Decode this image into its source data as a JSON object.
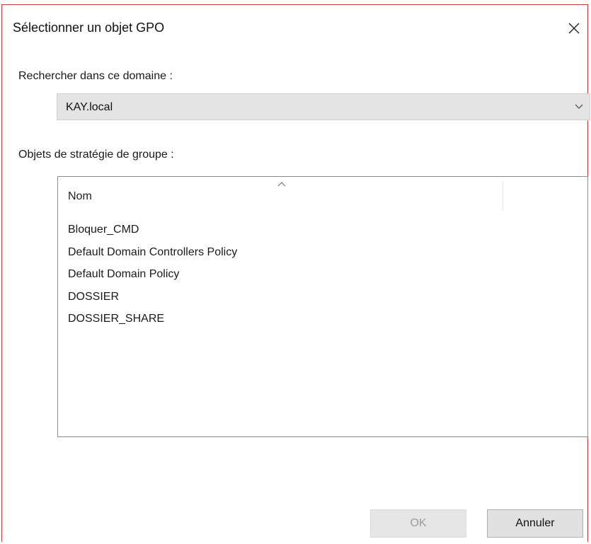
{
  "window": {
    "title": "Sélectionner un objet GPO"
  },
  "domain": {
    "label": "Rechercher dans ce domaine :",
    "selected": "KAY.local"
  },
  "gpo_list": {
    "label": "Objets de stratégie de groupe :",
    "column_header": "Nom",
    "sort": "ascending",
    "items": [
      "Bloquer_CMD",
      "Default Domain Controllers Policy",
      "Default Domain Policy",
      "DOSSIER",
      "DOSSIER_SHARE"
    ]
  },
  "buttons": {
    "ok_label": "OK",
    "ok_enabled": false,
    "cancel_label": "Annuler"
  },
  "colors": {
    "window_border": "#d23a3a",
    "select_bg": "#e4e4e4",
    "button_bg": "#e1e1e1",
    "disabled_text": "#9a9a9a"
  },
  "icons": {
    "close": "close-icon",
    "dropdown": "chevron-down-icon",
    "sort": "sort-ascending-icon"
  }
}
